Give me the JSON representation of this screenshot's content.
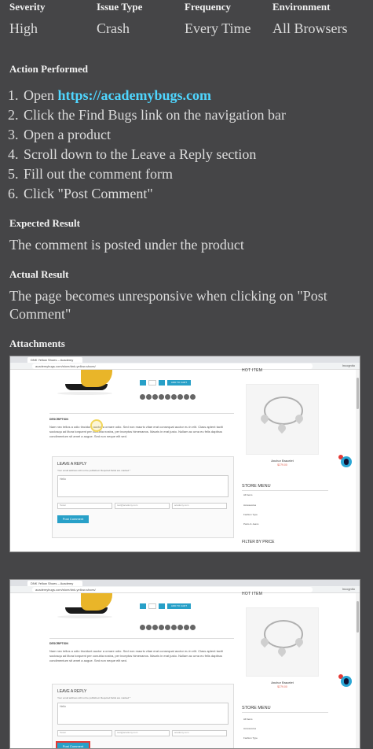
{
  "summary": {
    "headers": [
      "Severity",
      "Issue Type",
      "Frequency",
      "Environment"
    ],
    "values": [
      "High",
      "Crash",
      "Every Time",
      "All Browsers"
    ]
  },
  "action": {
    "title": "Action Performed",
    "steps": [
      {
        "num": "1.",
        "text": "Open ",
        "link": "https://academybugs.com"
      },
      {
        "num": "2.",
        "text": "Click the Find Bugs link on the navigation bar"
      },
      {
        "num": "3.",
        "text": "Open a product"
      },
      {
        "num": "4.",
        "text": "Scroll down to the Leave a Reply section"
      },
      {
        "num": "5.",
        "text": "Fill out the comment form"
      },
      {
        "num": "6.",
        "text": "Click \"Post Comment\""
      }
    ]
  },
  "expected": {
    "title": "Expected Result",
    "text": "The comment is posted under the product"
  },
  "actual": {
    "title": "Actual Result",
    "text": "The page becomes unresponsive when clicking on \"Post Comment\""
  },
  "attachments": {
    "title": "Attachments",
    "shots": [
      {
        "tab": "DNK Yellow Shoes – Academy",
        "url": "academybugs.com/store/dnk-yellow-shoes/",
        "add_to_cart": "ADD TO CART",
        "description_tab": "DESCRIPTION",
        "description_text": "Nam nec tellus a odio tincidunt auctor a ornare odio. Sed non mauris vitae erat consequat auctor eu in elit. Class aptent taciti sociosqu ad litora torquent per conubia nostra, per inceptos himenaeos. Mauris in erat justo. Nullam ac urna eu felis dapibus condimentum sit amet a augue. Sed non neque elit sed.",
        "reply_title": "LEAVE A REPLY",
        "reply_note": "Your email address will not be published. Required fields are marked *",
        "comment": "Hello",
        "name": "Tester",
        "email": "test@academy.com",
        "website": "academy.com",
        "post": "Post Comment",
        "side_top": "HOT ITEM",
        "product_name": "Anchor Bracelet",
        "product_price": "$279.00",
        "store_menu": "STORE MENU",
        "menu_items": [
          "All Items",
          "Accessories",
          "Fashion Type",
          "Pants & Jeans"
        ],
        "filter": "FILTER BY PRICE",
        "incognito": "Incognito"
      },
      {
        "tab": "DNK Yellow Shoes – Academy",
        "url": "academybugs.com/store/dnk-yellow-shoes/",
        "add_to_cart": "ADD TO CART",
        "description_tab": "DESCRIPTION",
        "description_text": "Nam nec tellus a odio tincidunt auctor a ornare odio. Sed non mauris vitae erat consequat auctor eu in elit. Class aptent taciti sociosqu ad litora torquent per conubia nostra, per inceptos himenaeos. Mauris in erat justo. Nullam ac urna eu felis dapibus condimentum sit amet a augue. Sed non neque elit sed.",
        "reply_title": "LEAVE A REPLY",
        "reply_note": "Your email address will not be published. Required fields are marked *",
        "comment": "Hello",
        "name": "Tester",
        "email": "test@academy.com",
        "website": "academy.com",
        "post": "Post Comment",
        "side_top": "HOT ITEM",
        "product_name": "Anchor Bracelet",
        "product_price": "$279.00",
        "store_menu": "STORE MENU",
        "menu_items": [
          "All Items",
          "Accessories",
          "Fashion Type"
        ],
        "incognito": "Incognito"
      }
    ]
  }
}
